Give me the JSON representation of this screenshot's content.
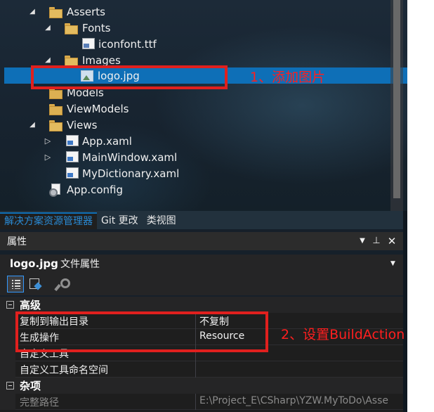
{
  "tree": {
    "items": [
      {
        "label": "Asserts",
        "icon": "folder-open-icon",
        "expanded": true
      },
      {
        "label": "Fonts",
        "icon": "folder-open-icon",
        "expanded": true
      },
      {
        "label": "iconfont.ttf",
        "icon": "font-file-icon"
      },
      {
        "label": "Images",
        "icon": "folder-open-icon",
        "expanded": true
      },
      {
        "label": "logo.jpg",
        "icon": "image-file-icon",
        "selected": true
      },
      {
        "label": "Models",
        "icon": "folder-icon"
      },
      {
        "label": "ViewModels",
        "icon": "folder-icon"
      },
      {
        "label": "Views",
        "icon": "folder-open-icon",
        "expanded": true
      },
      {
        "label": "App.xaml",
        "icon": "xaml-file-icon",
        "collapsed": true
      },
      {
        "label": "MainWindow.xaml",
        "icon": "xaml-file-icon",
        "collapsed": true
      },
      {
        "label": "MyDictionary.xaml",
        "icon": "xaml-file-icon"
      },
      {
        "label": "App.config",
        "icon": "config-file-icon"
      }
    ]
  },
  "explorer_tabs": [
    "解决方案资源管理器",
    "Git 更改",
    "类视图"
  ],
  "properties": {
    "title": "属性",
    "object_name": "logo.jpg",
    "object_kind": "文件属性",
    "categories": [
      {
        "label": "高级",
        "rows": [
          {
            "name": "复制到输出目录",
            "value": "不复制"
          },
          {
            "name": "生成操作",
            "value": "Resource"
          },
          {
            "name": "自定义工具",
            "value": ""
          },
          {
            "name": "自定义工具命名空间",
            "value": ""
          }
        ]
      },
      {
        "label": "杂项",
        "rows": [
          {
            "name": "完整路径",
            "value": "E:\\Project_E\\CSharp\\YZW.MyToDo\\Asse"
          }
        ]
      }
    ]
  },
  "annotations": {
    "step1": "1、添加图片",
    "step2": "2、设置BuildAction"
  },
  "colors": {
    "selection": "#0e6fb7",
    "annotation": "#e0201e"
  }
}
